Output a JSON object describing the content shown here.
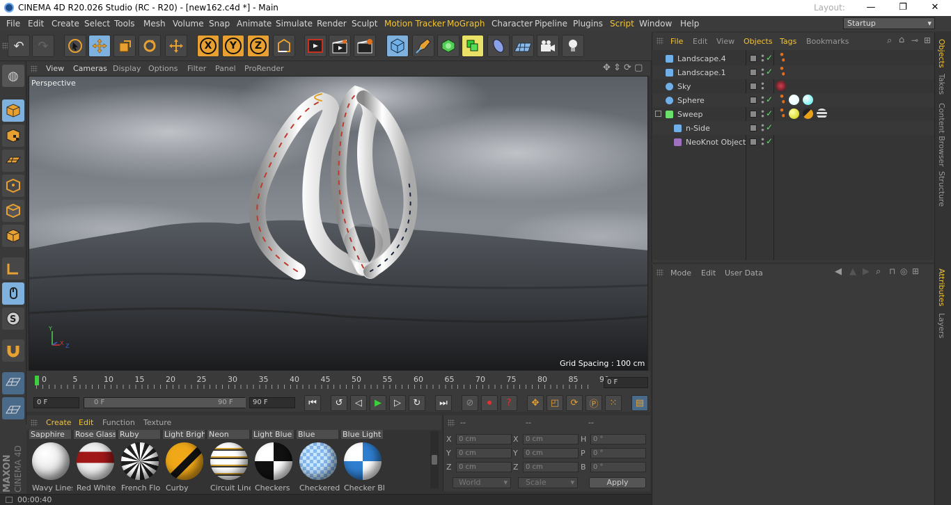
{
  "window": {
    "title": "CINEMA 4D R20.026 Studio (RC - R20) - [new162.c4d *] - Main",
    "minimize": "—",
    "maximize": "❐",
    "close": "✕"
  },
  "menu": {
    "items": [
      "File",
      "Edit",
      "Create",
      "Select",
      "Tools",
      "Mesh",
      "Volume",
      "Snap",
      "Animate",
      "Simulate",
      "Render",
      "Sculpt",
      "Motion Tracker",
      "MoGraph",
      "Character",
      "Pipeline",
      "Plugins",
      "Script",
      "Window",
      "Help"
    ],
    "highlighted": [
      "Motion Tracker",
      "MoGraph",
      "Script"
    ],
    "layout_label": "Layout:",
    "layout_value": "Startup"
  },
  "toolbar": {
    "undo": "undo-icon",
    "redo": "redo-icon",
    "axes": [
      "X",
      "Y",
      "Z"
    ]
  },
  "viewport": {
    "menu": [
      "View",
      "Cameras",
      "Display",
      "Options",
      "Filter",
      "Panel",
      "ProRender"
    ],
    "camera": "Perspective",
    "grid_spacing": "Grid Spacing : 100 cm",
    "axis": {
      "y": "Y",
      "x": "X",
      "z": "Z"
    }
  },
  "timeline": {
    "ticks": [
      "0",
      "5",
      "10",
      "15",
      "20",
      "25",
      "30",
      "35",
      "40",
      "45",
      "50",
      "55",
      "60",
      "65",
      "70",
      "75",
      "80",
      "85",
      "90"
    ],
    "current_frame": "0 F"
  },
  "transport": {
    "start": "0 F",
    "range_start": "0 F",
    "range_end": "90 F",
    "end": "90 F"
  },
  "materials": {
    "menu": [
      "Create",
      "Edit",
      "Function",
      "Texture"
    ],
    "items": [
      {
        "name": "Sapphire",
        "sub": "Wavy Lines",
        "colors": [
          "#f5f5f5",
          "#c8c8c8"
        ]
      },
      {
        "name": "Rose Glass",
        "sub": "Red White",
        "colors": [
          "#f0f0f0",
          "#a01818"
        ]
      },
      {
        "name": "Ruby",
        "sub": "French Flo",
        "colors": [
          "#ffffff",
          "#222222"
        ]
      },
      {
        "name": "Light Brigh",
        "sub": "Curby",
        "colors": [
          "#f0a818",
          "#111111"
        ]
      },
      {
        "name": "Neon",
        "sub": "Circuit Line",
        "colors": [
          "#ffffff",
          "#d4a030"
        ]
      },
      {
        "name": "Light Blue",
        "sub": "Checkers",
        "colors": [
          "#ffffff",
          "#111111"
        ]
      },
      {
        "name": "Blue",
        "sub": "Checkered",
        "colors": [
          "#c8e8ff",
          "#88b8f0"
        ]
      },
      {
        "name": "Blue Light",
        "sub": "Checker Bl",
        "colors": [
          "#ffffff",
          "#2f7fd0"
        ]
      }
    ]
  },
  "coords": {
    "headers": [
      "--",
      "--",
      "--"
    ],
    "rows": [
      {
        "l1": "X",
        "v1": "0 cm",
        "l2": "X",
        "v2": "0 cm",
        "l3": "H",
        "v3": "0 °"
      },
      {
        "l1": "Y",
        "v1": "0 cm",
        "l2": "Y",
        "v2": "0 cm",
        "l3": "P",
        "v3": "0 °"
      },
      {
        "l1": "Z",
        "v1": "0 cm",
        "l2": "Z",
        "v2": "0 cm",
        "l3": "B",
        "v3": "0 °"
      }
    ],
    "world": "World",
    "scale": "Scale",
    "apply": "Apply"
  },
  "status": {
    "time": "00:00:40"
  },
  "objects": {
    "menu": [
      "File",
      "Edit",
      "View",
      "Objects",
      "Tags",
      "Bookmarks"
    ],
    "highlighted": [
      "File",
      "Objects",
      "Tags"
    ],
    "rows": [
      {
        "name": "Landscape.4",
        "indent": 0,
        "icon": "landscape-icon",
        "color": "#6fb0e8"
      },
      {
        "name": "Landscape.1",
        "indent": 0,
        "icon": "landscape-icon",
        "color": "#6fb0e8"
      },
      {
        "name": "Sky",
        "indent": 0,
        "icon": "sky-icon",
        "color": "#6fb0e8"
      },
      {
        "name": "Sphere",
        "indent": 0,
        "icon": "sphere-icon",
        "color": "#6fb0e8"
      },
      {
        "name": "Sweep",
        "indent": 0,
        "icon": "sweep-icon",
        "color": "#6be06b"
      },
      {
        "name": "n-Side",
        "indent": 1,
        "icon": "nside-icon",
        "color": "#6fb0e8"
      },
      {
        "name": "NeoKnot Object",
        "indent": 1,
        "icon": "neoknot-icon",
        "color": "#a070c0"
      }
    ]
  },
  "attributes": {
    "menu": [
      "Mode",
      "Edit",
      "User Data"
    ]
  },
  "right_tabs": [
    "Objects",
    "Takes",
    "Content Browser",
    "Structure",
    "Attributes",
    "Layers"
  ]
}
